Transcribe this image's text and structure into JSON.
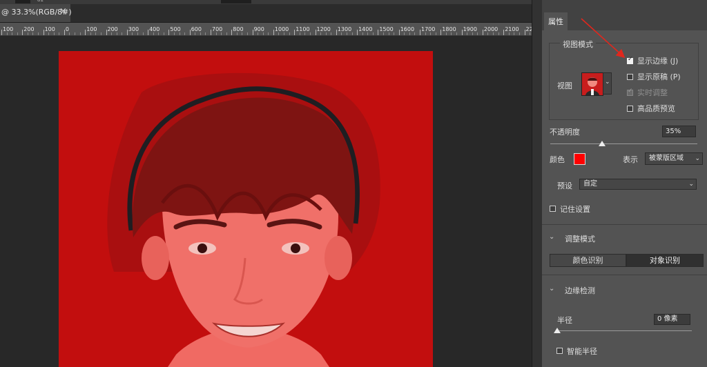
{
  "document_tab": {
    "title": "@ 33.3%(RGB/8#)",
    "close_symbol": "×"
  },
  "top_strip": {
    "tiny_label": "81"
  },
  "ruler": {
    "ticks": [
      "100",
      "200",
      "100",
      "0",
      "100",
      "200",
      "300",
      "400",
      "500",
      "600",
      "700",
      "800",
      "900",
      "1000",
      "1100",
      "1200",
      "1300",
      "1400",
      "1500",
      "1600",
      "1700",
      "1800",
      "1900",
      "2000",
      "2100",
      "22"
    ]
  },
  "properties_panel": {
    "tab_label": "属性",
    "view_mode": {
      "title": "视图模式",
      "view_label": "视图",
      "options": [
        {
          "label": "显示边缘 (J)",
          "checked": true,
          "enabled": true
        },
        {
          "label": "显示原稿 (P)",
          "checked": false,
          "enabled": true
        },
        {
          "label": "实时调整",
          "checked": true,
          "enabled": false
        },
        {
          "label": "高品质预览",
          "checked": false,
          "enabled": true
        }
      ]
    },
    "opacity": {
      "label": "不透明度",
      "value": "35%",
      "level": 0.35
    },
    "color": {
      "label": "颜色",
      "swatch": "#ff0000"
    },
    "indicates": {
      "label": "表示",
      "value": "被蒙版区域"
    },
    "preset": {
      "label": "预设",
      "value": "自定"
    },
    "remember": {
      "label": "记住设置",
      "checked": false
    },
    "adjust_mode": {
      "title": "调整模式",
      "buttons": [
        "颜色识别",
        "对象识别"
      ],
      "selected": "对象识别"
    },
    "edge_detection": {
      "title": "边缘检测",
      "radius": {
        "label": "半径",
        "value": "0 像素",
        "level": 0
      },
      "smart_radius": {
        "label": "智能半径",
        "checked": false
      }
    }
  },
  "colors": {
    "overlay_red": "#c20e0e",
    "panel_bg": "#535353",
    "annotation_arrow": "#e0271d"
  }
}
